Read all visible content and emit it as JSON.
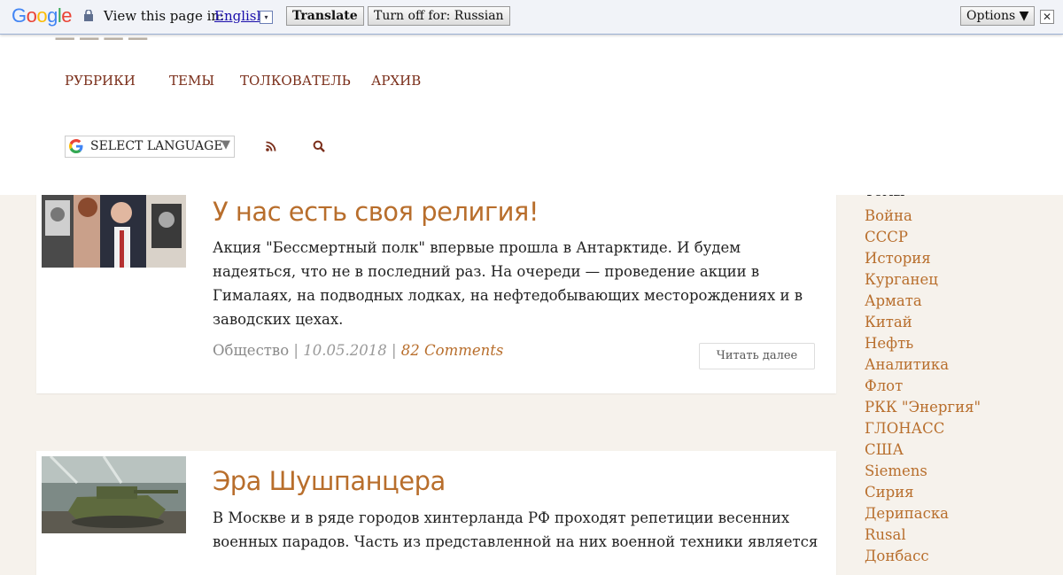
{
  "translate_bar": {
    "logo": "Google",
    "view_text": "View this page in:",
    "language": "English",
    "dropdown_arrow": "▾",
    "translate_label": "Translate",
    "turn_off_label": "Turn off for: Russian",
    "options_label": "Options ▼",
    "close_label": "✕"
  },
  "header": {
    "nav": [
      "РУБРИКИ",
      "ТЕМЫ",
      "ТОЛКОВАТЕЛЬ",
      "АРХИВ"
    ],
    "select_language": "SELECT LANGUAGE",
    "select_arrow": "▼",
    "icons": [
      "rss-icon",
      "search-icon"
    ]
  },
  "posts": [
    {
      "title": "У нас есть своя религия!",
      "excerpt": "Акция \"Бессмертный полк\" впервые прошла в Антарктиде. И будем надеяться, что не в последний раз. На очереди — проведение акции в Гималаях, на подводных лодках, на нефтедобывающих месторождениях и в заводских цехах.",
      "category": "Общество",
      "separator": "|",
      "date": "10.05.2018",
      "comments": "82 Comments",
      "read_more": "Читать далее"
    },
    {
      "title": "Эра Шушпанцера",
      "excerpt": "В Москве и в ряде городов хинтерланда РФ проходят репетиции весенних военных парадов. Часть из представленной на них военной техники является"
    }
  ],
  "sidebar": {
    "title": "Темы",
    "tags": [
      "Война",
      "СССР",
      "История",
      "Курганец",
      "Армата",
      "Китай",
      "Нефть",
      "Аналитика",
      "Флот",
      "РКК \"Энергия\"",
      "ГЛОНАСС",
      "США",
      "Siemens",
      "Сирия",
      "Дерипаска",
      "Rusal",
      "Донбасс"
    ]
  },
  "colors": {
    "accent": "#b86e2c",
    "nav": "#7a2e1a",
    "background": "#f6f2ec"
  }
}
